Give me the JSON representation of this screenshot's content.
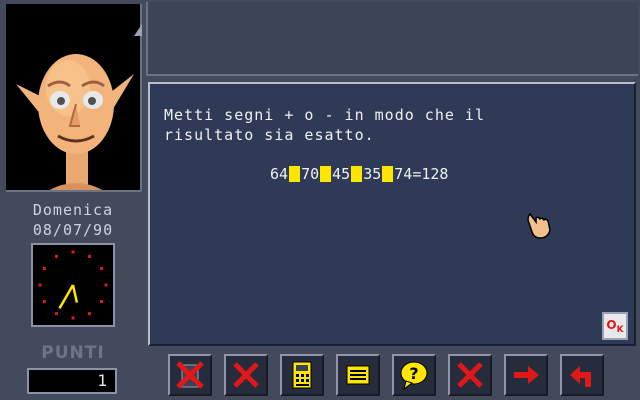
{
  "profile": {
    "day": "Domenica",
    "date": "08/07/90",
    "clock_hour": 5,
    "clock_minute": 35
  },
  "score": {
    "label": "PUNTI",
    "value": "1"
  },
  "puzzle": {
    "line1": "Metti segni + o - in modo che il",
    "line2": "risultato sia esatto.",
    "numbers": [
      "64",
      "70",
      "45",
      "35",
      "74"
    ],
    "result_text": "=128"
  },
  "ok_button": {
    "label_o": "O",
    "label_k": "K"
  },
  "toolbar": {
    "buttons": [
      {
        "icon": "crossed-out-trash-icon"
      },
      {
        "icon": "red-x-icon"
      },
      {
        "icon": "calculator-icon"
      },
      {
        "icon": "notepad-icon"
      },
      {
        "icon": "help-speech-bubble-icon"
      },
      {
        "icon": "red-x-icon"
      },
      {
        "icon": "right-arrow-icon"
      },
      {
        "icon": "return-arrow-icon"
      }
    ]
  },
  "colors": {
    "background": "#434a5c",
    "dialog": "#2e3a56",
    "slot": "#ffe600",
    "accent_red": "#e01818"
  }
}
